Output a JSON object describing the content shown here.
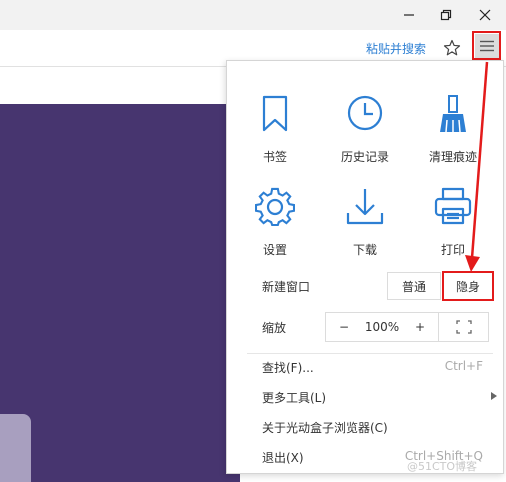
{
  "window": {
    "minimize_icon": "minimize-icon",
    "restore_icon": "restore-icon",
    "close_icon": "close-icon"
  },
  "toolbar": {
    "paste_search": "粘贴并搜索",
    "star_icon": "star-icon",
    "menu_icon": "hamburger-menu-icon"
  },
  "menu": {
    "grid": [
      {
        "label": "书签",
        "icon": "bookmark-icon"
      },
      {
        "label": "历史记录",
        "icon": "clock-icon"
      },
      {
        "label": "清理痕迹",
        "icon": "broom-icon"
      },
      {
        "label": "设置",
        "icon": "gear-icon"
      },
      {
        "label": "下载",
        "icon": "download-icon"
      },
      {
        "label": "打印",
        "icon": "printer-icon"
      }
    ],
    "new_window_label": "新建窗口",
    "normal_label": "普通",
    "incognito_label": "隐身",
    "zoom_label": "缩放",
    "zoom_minus": "−",
    "zoom_value": "100%",
    "zoom_plus": "+",
    "fullscreen_icon": "fullscreen-icon",
    "items": [
      {
        "label": "查找(F)...",
        "shortcut": "Ctrl+F"
      },
      {
        "label": "更多工具(L)",
        "shortcut": ""
      },
      {
        "label": "关于光动盒子浏览器(C)",
        "shortcut": ""
      },
      {
        "label": "退出(X)",
        "shortcut": "Ctrl+Shift+Q"
      }
    ],
    "accent_color": "#2d7fd3",
    "highlight_color": "#e31b1b"
  },
  "watermark": "@51CTO博客"
}
